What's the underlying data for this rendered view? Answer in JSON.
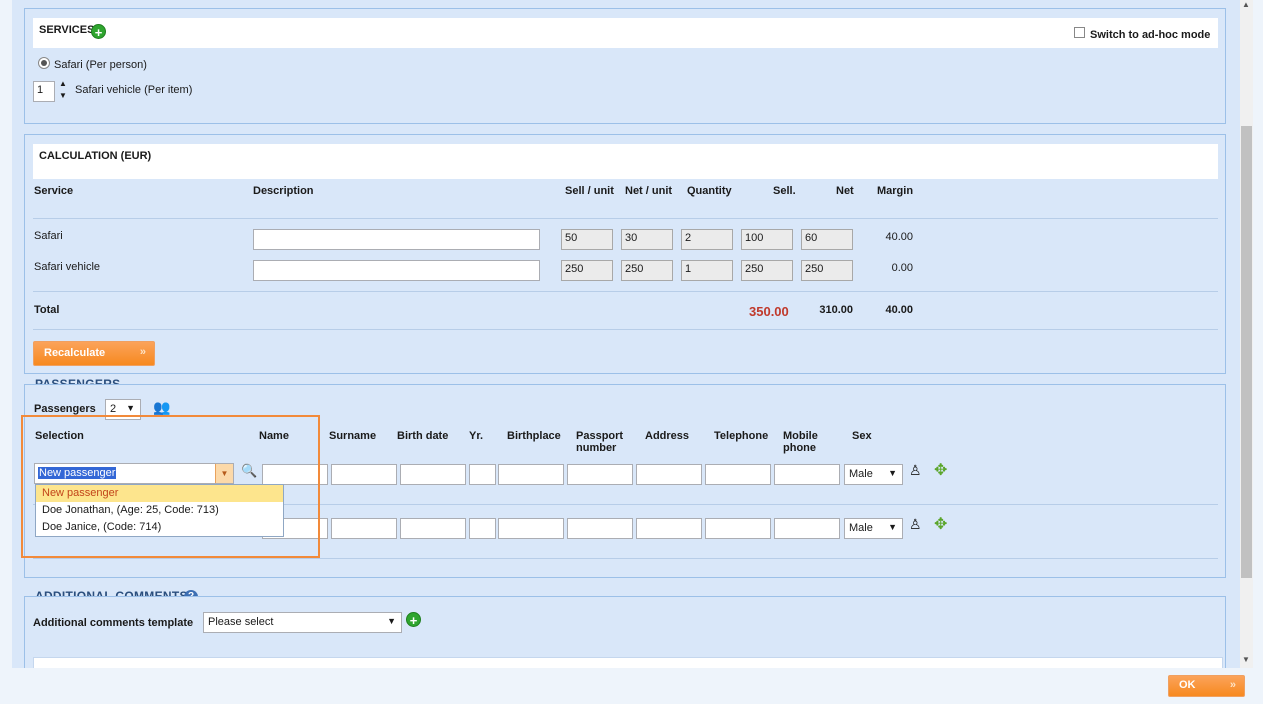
{
  "services": {
    "title": "SERVICES",
    "adhoc_label": "Switch to ad-hoc mode",
    "radio_label": "Safari (Per person)",
    "stepper_value": "1",
    "stepper_label": "Safari vehicle (Per item)"
  },
  "calculation": {
    "title": "CALCULATION (EUR)",
    "headers": {
      "service": "Service",
      "description": "Description",
      "sell_unit": "Sell / unit",
      "net_unit": "Net / unit",
      "quantity": "Quantity",
      "sell": "Sell.",
      "net": "Net",
      "margin": "Margin"
    },
    "rows": [
      {
        "service": "Safari",
        "description": "",
        "sell_unit": "50",
        "net_unit": "30",
        "quantity": "2",
        "sell": "100",
        "net": "60",
        "margin": "40.00"
      },
      {
        "service": "Safari vehicle",
        "description": "",
        "sell_unit": "250",
        "net_unit": "250",
        "quantity": "1",
        "sell": "250",
        "net": "250",
        "margin": "0.00"
      }
    ],
    "total": {
      "label": "Total",
      "sell": "350.00",
      "net": "310.00",
      "margin": "40.00"
    },
    "recalc_label": "Recalculate"
  },
  "passengers": {
    "title": "PASSENGERS",
    "count_label": "Passengers",
    "count_value": "2",
    "headers": {
      "selection": "Selection",
      "name": "Name",
      "surname": "Surname",
      "birth_date": "Birth date",
      "yr": "Yr.",
      "birthplace": "Birthplace",
      "passport": "Passport number",
      "address": "Address",
      "telephone": "Telephone",
      "mobile": "Mobile phone",
      "sex": "Sex"
    },
    "row1": {
      "selection": "New passenger",
      "sex": "Male"
    },
    "row2": {
      "sex": "Male"
    },
    "dropdown": [
      "New passenger",
      "Doe Jonathan, (Age: 25, Code: 713)",
      "Doe Janice, (Code: 714)"
    ]
  },
  "comments": {
    "title": "ADDITIONAL COMMENTS",
    "template_label": "Additional comments template",
    "template_value": "Please select"
  },
  "footer": {
    "ok_label": "OK"
  },
  "colors": {
    "accent_orange": "#f7891f",
    "panel_bg": "#d9e7f9",
    "total_red": "#c0392b",
    "highlight_box": "#f28a3a"
  }
}
